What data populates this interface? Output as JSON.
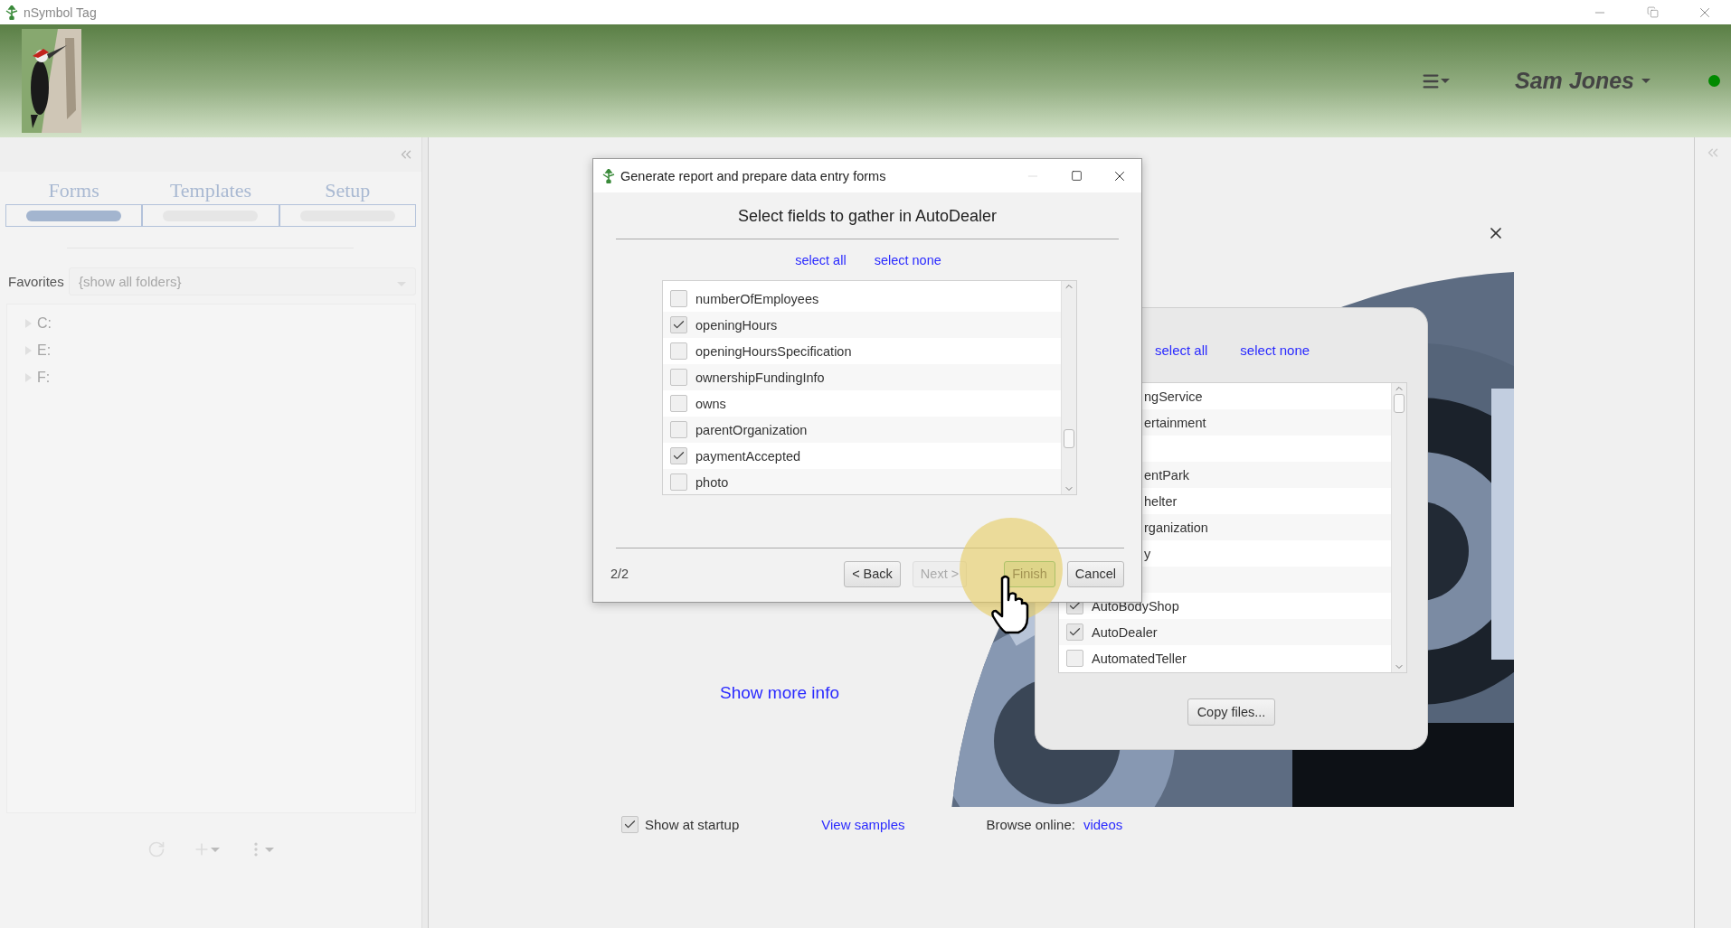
{
  "app": {
    "title": "nSymbol Tag"
  },
  "header": {
    "user": "Sam Jones",
    "online": true
  },
  "sidebar": {
    "tabs": [
      {
        "label": "Forms",
        "selected": true
      },
      {
        "label": "Templates",
        "selected": false
      },
      {
        "label": "Setup",
        "selected": false
      }
    ],
    "favorites": {
      "label": "Favorites",
      "placeholder": "{show all folders}"
    },
    "tree": [
      {
        "label": "C:",
        "expanded": false
      },
      {
        "label": "E:",
        "expanded": false
      },
      {
        "label": "F:",
        "expanded": false
      }
    ]
  },
  "welcome": {
    "more_info": "Show more info",
    "show_at_startup": {
      "label": "Show at startup",
      "checked": true
    },
    "view_samples": "View samples",
    "browse_label": "Browse online:",
    "videos": "videos"
  },
  "back_window": {
    "select_all": "select all",
    "select_none": "select none",
    "copy_button": "Copy files...",
    "rows": [
      {
        "kind": "fragment",
        "text": "ngService"
      },
      {
        "kind": "fragment",
        "text": "ertainment"
      },
      {
        "kind": "covered"
      },
      {
        "kind": "fragment",
        "text": "entPark"
      },
      {
        "kind": "fragment",
        "text": "helter"
      },
      {
        "kind": "fragment",
        "text": "rganization"
      },
      {
        "kind": "fragment",
        "text": "y"
      },
      {
        "kind": "covered"
      },
      {
        "kind": "check",
        "text": "AutoBodyShop",
        "checked": true
      },
      {
        "kind": "check",
        "text": "AutoDealer",
        "checked": true
      },
      {
        "kind": "check",
        "text": "AutomatedTeller",
        "checked": false
      }
    ]
  },
  "dialog": {
    "title": "Generate report and prepare data entry forms",
    "heading": "Select fields to gather in AutoDealer",
    "select_all": "select all",
    "select_none": "select none",
    "page": "2/2",
    "fields": [
      {
        "label": "numberOfEmployees",
        "checked": false
      },
      {
        "label": "openingHours",
        "checked": true
      },
      {
        "label": "openingHoursSpecification",
        "checked": false
      },
      {
        "label": "ownershipFundingInfo",
        "checked": false
      },
      {
        "label": "owns",
        "checked": false
      },
      {
        "label": "parentOrganization",
        "checked": false
      },
      {
        "label": "paymentAccepted",
        "checked": true
      },
      {
        "label": "photo",
        "checked": false
      }
    ],
    "buttons": [
      {
        "label": "< Back",
        "kind": "normal"
      },
      {
        "label": "Next >",
        "kind": "disabled"
      },
      {
        "label": "Finish",
        "kind": "default"
      },
      {
        "label": "Cancel",
        "kind": "normal"
      }
    ]
  }
}
